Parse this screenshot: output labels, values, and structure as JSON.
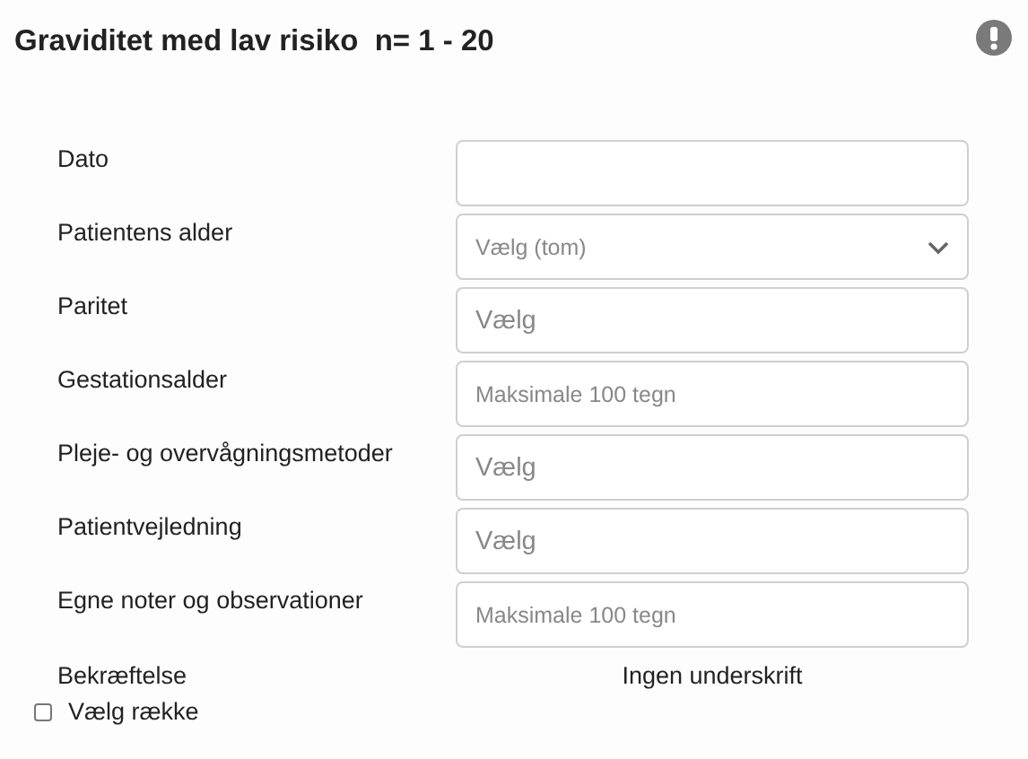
{
  "title": "Graviditet med lav risiko  n= 1 - 20",
  "fields": [
    {
      "label": "Dato",
      "kind": "text"
    },
    {
      "label": "Patientens alder",
      "kind": "select",
      "placeholder": "Vælg (tom)"
    },
    {
      "label": "Paritet",
      "kind": "text",
      "placeholder": "Vælg"
    },
    {
      "label": "Gestationsalder",
      "kind": "note",
      "placeholder": "Maksimale 100 tegn"
    },
    {
      "label": "Pleje- og overvågningsmetoder",
      "kind": "text",
      "placeholder": "Vælg"
    },
    {
      "label": "Patientvejledning",
      "kind": "text",
      "placeholder": "Vælg"
    },
    {
      "label": "Egne noter og observationer",
      "kind": "note",
      "placeholder": "Maksimale 100 tegn"
    }
  ],
  "confirmation": {
    "label": "Bekræftelse",
    "value": "Ingen underskrift"
  },
  "select_row": {
    "label": "Vælg række",
    "checked": false
  }
}
